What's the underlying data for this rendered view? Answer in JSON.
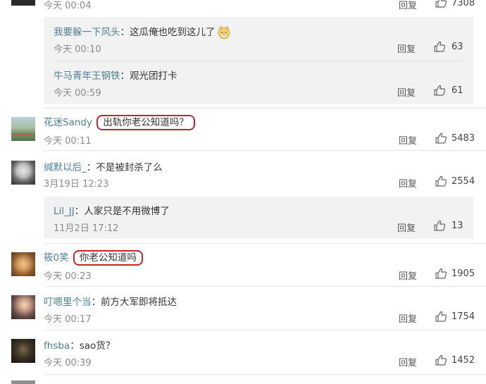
{
  "reply_label": "回复",
  "comments": [
    {
      "id": "c0",
      "time": "今天 00:04",
      "likes": "7308"
    },
    {
      "id": "c1",
      "user": "花迷Sandy",
      "text": "出轨你老公知道吗？",
      "time": "今天 00:11",
      "likes": "5483"
    },
    {
      "id": "c2",
      "user": "缄默以后_",
      "text": "不是被封杀了么",
      "time": "3月19日 12:23",
      "likes": "2554"
    },
    {
      "id": "c3",
      "user": "筱0笑",
      "text": "你老公知道吗",
      "time": "今天 00:23",
      "likes": "1905"
    },
    {
      "id": "c4",
      "user": "叮嗯里个当",
      "text": "前方大军即将抵达",
      "time": "今天 00:17",
      "likes": "1754"
    },
    {
      "id": "c5",
      "user": "fhsba",
      "text": "sao货？",
      "time": "今天 00:39",
      "likes": "1452"
    }
  ],
  "replies": [
    {
      "user": "我要躲一下风头",
      "text": "这瓜俺也吃到这儿了",
      "time": "今天 00:10",
      "likes": "63"
    },
    {
      "user": "牛马青年王钢铁",
      "text": "观光团打卡",
      "time": "今天 00:59",
      "likes": "61"
    },
    {
      "user": "Lil_JJ",
      "text": "人家只是不用微博了",
      "time": "11月2日 17:12",
      "likes": "13"
    }
  ],
  "colors": {
    "username": "#4b7f95",
    "highlight_circle": "#c0282c",
    "sub_bg": "#f2f2f2"
  },
  "icons": {
    "like": "thumbs-up-icon",
    "avatar": "user-avatar"
  }
}
